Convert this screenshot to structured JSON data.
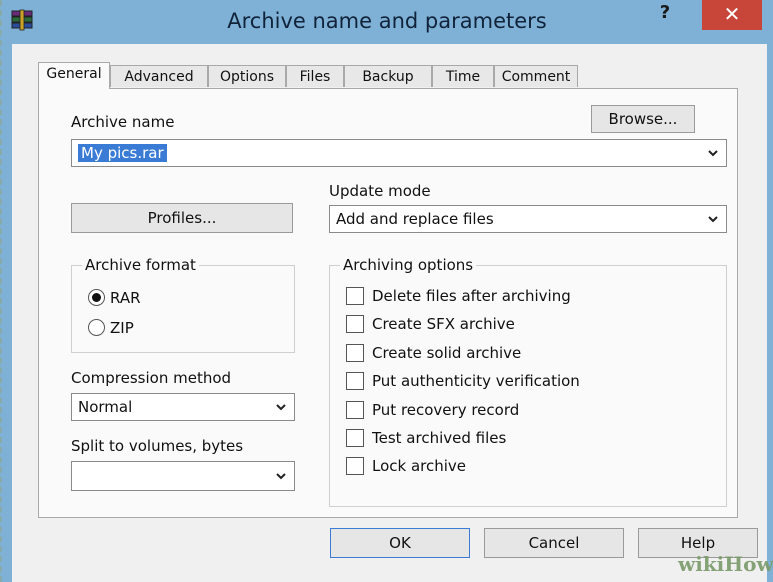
{
  "window": {
    "title": "Archive name and parameters",
    "help_label": "?",
    "close_label": "✕"
  },
  "tabs": [
    {
      "label": "General",
      "active": true
    },
    {
      "label": "Advanced"
    },
    {
      "label": "Options"
    },
    {
      "label": "Files"
    },
    {
      "label": "Backup"
    },
    {
      "label": "Time"
    },
    {
      "label": "Comment"
    }
  ],
  "archive_name": {
    "label": "Archive name",
    "value": "My pics.rar",
    "browse_label": "Browse..."
  },
  "update_mode": {
    "label": "Update mode",
    "value": "Add and replace files"
  },
  "profiles_label": "Profiles...",
  "archive_format": {
    "title": "Archive format",
    "options": [
      {
        "label": "RAR",
        "selected": true
      },
      {
        "label": "ZIP",
        "selected": false
      }
    ]
  },
  "archiving_options": {
    "title": "Archiving options",
    "items": [
      {
        "label": "Delete files after archiving",
        "checked": false
      },
      {
        "label": "Create SFX archive",
        "checked": false
      },
      {
        "label": "Create solid archive",
        "checked": false
      },
      {
        "label": "Put authenticity verification",
        "checked": false
      },
      {
        "label": "Put recovery record",
        "checked": false
      },
      {
        "label": "Test archived files",
        "checked": false
      },
      {
        "label": "Lock archive",
        "checked": false
      }
    ]
  },
  "compression": {
    "label": "Compression method",
    "value": "Normal"
  },
  "split": {
    "label": "Split to volumes, bytes",
    "value": ""
  },
  "footer": {
    "ok_label": "OK",
    "cancel_label": "Cancel",
    "help_label": "Help"
  },
  "watermark": "wikiHow",
  "colors": {
    "titlebar": "#7fb1d6",
    "close": "#c8453a",
    "selection": "#3a7bd5"
  }
}
